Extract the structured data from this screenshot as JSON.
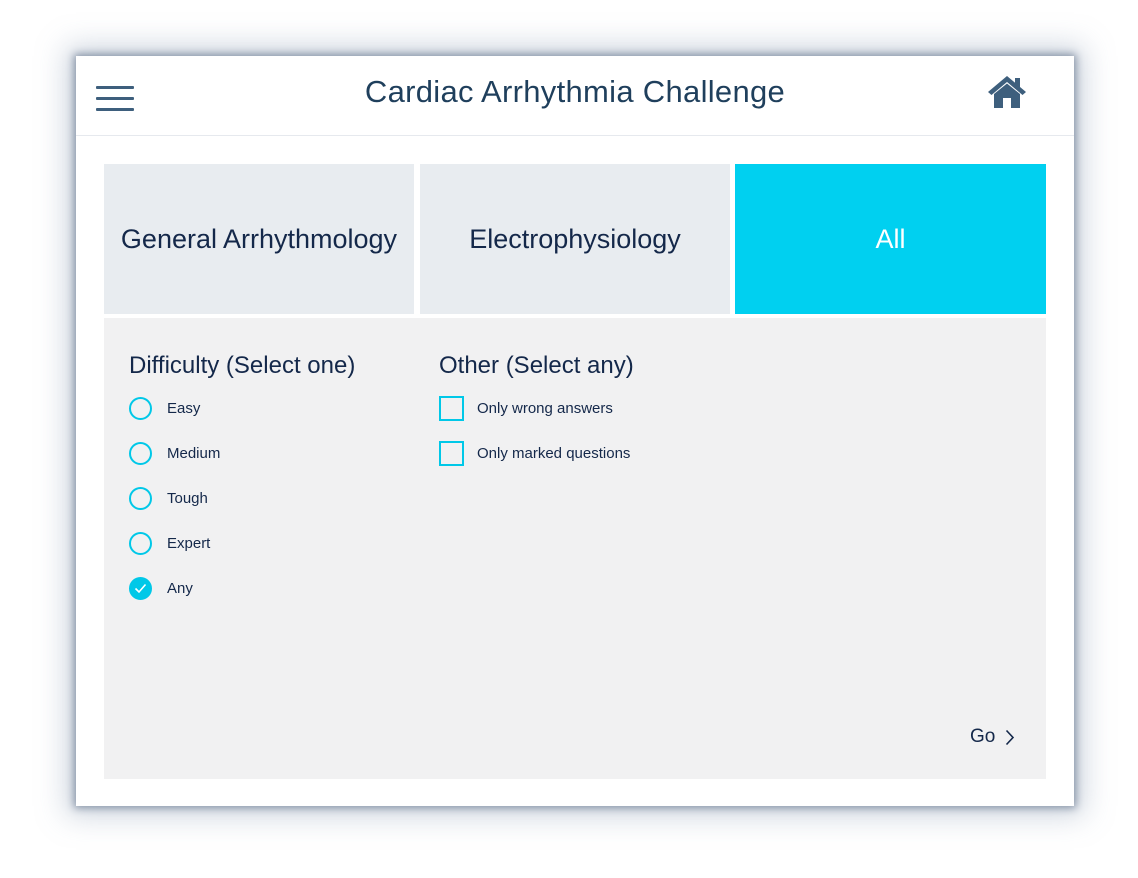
{
  "header": {
    "title": "Cardiac Arrhythmia Challenge",
    "menu_icon": "hamburger-menu-icon",
    "home_icon": "home-icon"
  },
  "tabs": [
    {
      "label": "General Arrhythmology",
      "active": false
    },
    {
      "label": "Electrophysiology",
      "active": false
    },
    {
      "label": "All",
      "active": true
    }
  ],
  "difficulty": {
    "title": "Difficulty (Select one)",
    "options": [
      {
        "label": "Easy",
        "checked": false
      },
      {
        "label": "Medium",
        "checked": false
      },
      {
        "label": "Tough",
        "checked": false
      },
      {
        "label": "Expert",
        "checked": false
      },
      {
        "label": "Any",
        "checked": true
      }
    ]
  },
  "other": {
    "title": "Other (Select any)",
    "options": [
      {
        "label": "Only wrong answers",
        "checked": false
      },
      {
        "label": "Only marked questions",
        "checked": false
      }
    ]
  },
  "go": {
    "label": "Go",
    "icon": "chevron-right-icon"
  },
  "colors": {
    "accent": "#00d0f0",
    "title_text": "#1f3f5c",
    "body_text": "#14284a",
    "icon": "#3e5f7d",
    "tab_bg": "#e8ecf0",
    "panel_bg": "#f1f1f2"
  }
}
